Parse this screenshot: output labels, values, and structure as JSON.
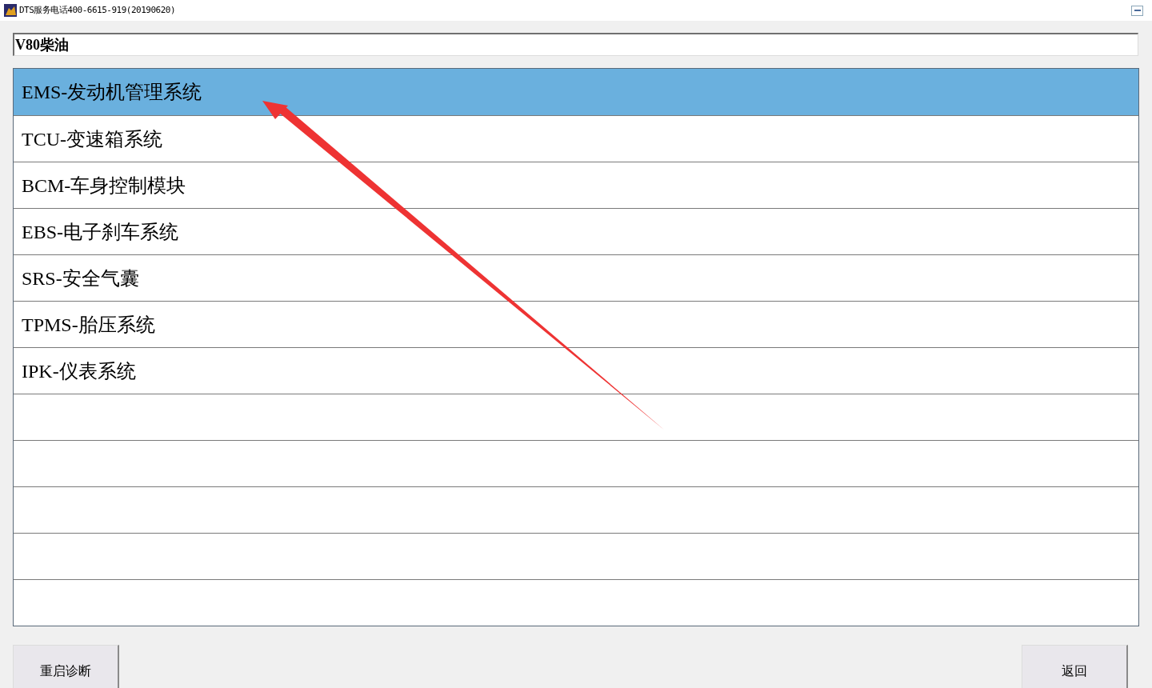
{
  "window": {
    "title": "DTS服务电话400-6615-919(20190620)"
  },
  "vehicle_field": {
    "value": "V80柴油"
  },
  "systems": [
    {
      "kind": "item",
      "label": "EMS-发动机管理系统",
      "selected": true
    },
    {
      "kind": "item",
      "label": "TCU-变速箱系统",
      "selected": false
    },
    {
      "kind": "item",
      "label": "BCM-车身控制模块",
      "selected": false
    },
    {
      "kind": "item",
      "label": "EBS-电子刹车系统",
      "selected": false
    },
    {
      "kind": "item",
      "label": "SRS-安全气囊",
      "selected": false
    },
    {
      "kind": "item",
      "label": "TPMS-胎压系统",
      "selected": false
    },
    {
      "kind": "item",
      "label": "IPK-仪表系统",
      "selected": false
    },
    {
      "kind": "empty",
      "selected": false
    },
    {
      "kind": "empty",
      "selected": false
    },
    {
      "kind": "empty",
      "selected": false
    },
    {
      "kind": "empty",
      "selected": false
    },
    {
      "kind": "empty",
      "selected": false
    }
  ],
  "buttons": [
    "重启诊断",
    "返回"
  ]
}
